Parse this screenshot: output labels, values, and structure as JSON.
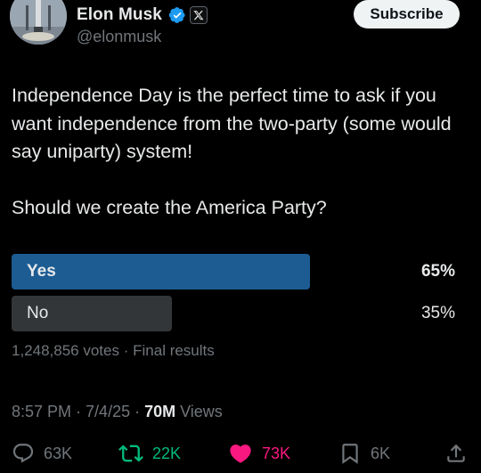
{
  "author": {
    "display_name": "Elon Musk",
    "handle": "@elonmusk",
    "verified_icon": "verified-badge-icon",
    "affiliate_icon": "x-logo-icon"
  },
  "subscribe_label": "Subscribe",
  "tweet": {
    "paragraph_1": "Independence Day is the perfect time to ask if you want independence from the two-party (some would say uniparty) system!",
    "paragraph_2": "Should we create the America Party?"
  },
  "poll": {
    "options": [
      {
        "label": "Yes",
        "percent_text": "65%",
        "percent": 65,
        "winner": true
      },
      {
        "label": "No",
        "percent_text": "35%",
        "percent": 35,
        "winner": false
      }
    ],
    "votes": "1,248,856 votes",
    "separator": "·",
    "status": "Final results"
  },
  "meta": {
    "time": "8:57 PM",
    "date": "7/4/25",
    "separator": "·",
    "views_count": "70M",
    "views_label": "Views"
  },
  "actions": {
    "replies": "63K",
    "reposts": "22K",
    "likes": "73K",
    "bookmarks": "6K"
  },
  "colors": {
    "background": "#000000",
    "text": "#e7e9ea",
    "secondary": "#71767b",
    "poll_winner": "#1d5c93",
    "poll_other": "#333639",
    "verified": "#1d9bf0",
    "repost": "#00ba7c",
    "like": "#f91880"
  }
}
